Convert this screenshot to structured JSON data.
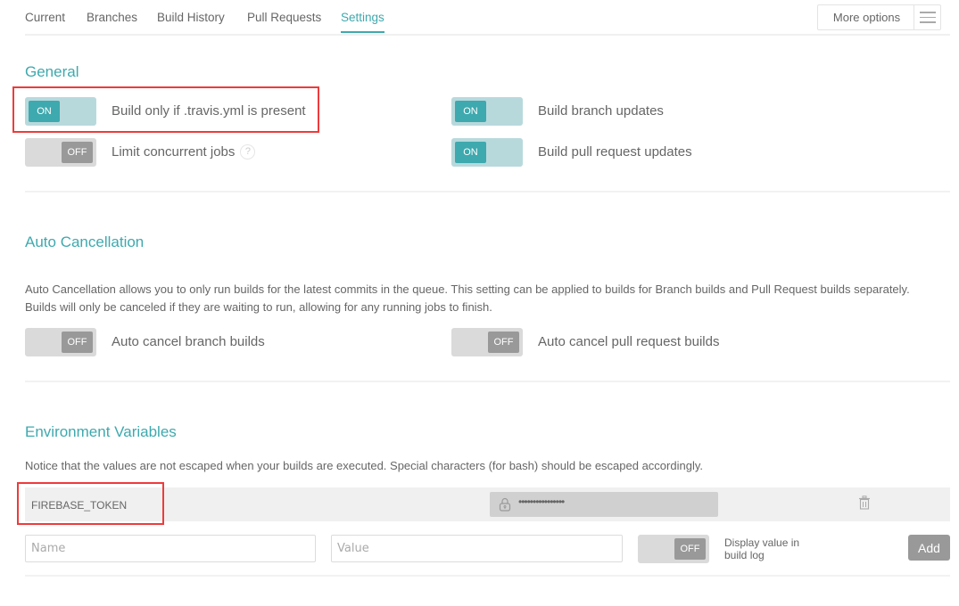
{
  "tabs": [
    {
      "label": "Current",
      "active": false
    },
    {
      "label": "Branches",
      "active": false
    },
    {
      "label": "Build History",
      "active": false
    },
    {
      "label": "Pull Requests",
      "active": false
    },
    {
      "label": "Settings",
      "active": true
    }
  ],
  "more_options": {
    "label": "More options",
    "icon": "hamburger-menu-icon"
  },
  "colors": {
    "accent": "#3ea9ae",
    "toggle_on_track": "#b8d9dc",
    "toggle_off_track": "#dadada",
    "toggle_off_knob": "#999999",
    "highlight": "#ee3b3b"
  },
  "general": {
    "title": "General",
    "settings": [
      {
        "label": "Build only if .travis.yml is present",
        "state": "ON",
        "highlighted": true
      },
      {
        "label": "Limit concurrent jobs",
        "state": "OFF",
        "help": "?"
      },
      {
        "label": "Build branch updates",
        "state": "ON"
      },
      {
        "label": "Build pull request updates",
        "state": "ON"
      }
    ]
  },
  "auto_cancellation": {
    "title": "Auto Cancellation",
    "description_line1": "Auto Cancellation allows you to only run builds for the latest commits in the queue. This setting can be applied to builds for Branch builds and Pull Request builds separately.",
    "description_line2": "Builds will only be canceled if they are waiting to run, allowing for any running jobs to finish.",
    "settings": [
      {
        "label": "Auto cancel branch builds",
        "state": "OFF"
      },
      {
        "label": "Auto cancel pull request builds",
        "state": "OFF"
      }
    ]
  },
  "env_vars": {
    "title": "Environment Variables",
    "notice": "Notice that the values are not escaped when your builds are executed. Special characters (for bash) should be escaped accordingly.",
    "variables": [
      {
        "name": "FIREBASE_TOKEN",
        "value_masked": "••••••••••••••••",
        "highlighted": true
      }
    ],
    "form": {
      "name_placeholder": "Name",
      "value_placeholder": "Value",
      "display_toggle_state": "OFF",
      "display_label_line1": "Display value in",
      "display_label_line2": "build log",
      "add_label": "Add"
    }
  }
}
